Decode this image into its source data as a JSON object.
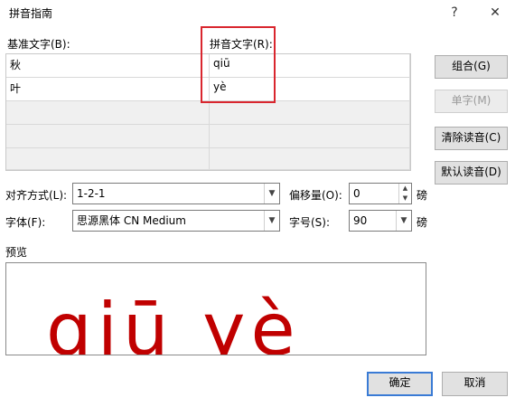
{
  "window": {
    "title": "拼音指南",
    "help_glyph": "?",
    "close_glyph": "✕"
  },
  "columns": {
    "base_label": "基准文字(B):",
    "pinyin_label": "拼音文字(R):"
  },
  "rows": [
    {
      "base": "秋",
      "pinyin": "qiū"
    },
    {
      "base": "叶",
      "pinyin": "yè"
    },
    {
      "base": "",
      "pinyin": ""
    },
    {
      "base": "",
      "pinyin": ""
    },
    {
      "base": "",
      "pinyin": ""
    }
  ],
  "buttons": {
    "combine": "组合(G)",
    "single": "单字(M)",
    "clear": "清除读音(C)",
    "default": "默认读音(D)",
    "ok": "确定",
    "cancel": "取消"
  },
  "options": {
    "align_label": "对齐方式(L):",
    "align_value": "1-2-1",
    "offset_label": "偏移量(O):",
    "offset_value": "0",
    "offset_unit": "磅",
    "font_label": "字体(F):",
    "font_value": "思源黑体 CN Medium",
    "size_label": "字号(S):",
    "size_value": "90",
    "size_unit": "磅"
  },
  "preview": {
    "label": "预览",
    "text": "qiū yè"
  },
  "colors": {
    "highlight_border": "#d9262e",
    "preview_text": "#c00000",
    "primary_border": "#3a7bd5"
  },
  "icons": {
    "dropdown": "chevron-down-icon",
    "spin_up": "spin-up-icon",
    "spin_down": "spin-down-icon"
  }
}
